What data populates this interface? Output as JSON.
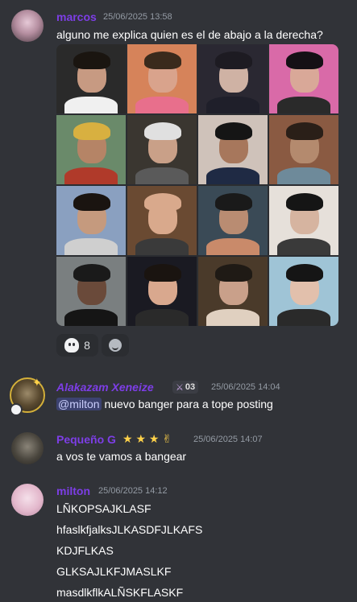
{
  "messages": [
    {
      "username": "marcos",
      "timestamp": "25/06/2025 13:58",
      "text": "alguno me explica quien es el de abajo a la derecha?",
      "reactions": [
        {
          "icon": "ghost-emoji-icon",
          "count": "8"
        },
        {
          "icon": "add-reaction-icon",
          "count": ""
        }
      ]
    },
    {
      "username": "Alakazam Xeneize",
      "badge": "03",
      "timestamp": "25/06/2025 14:04",
      "mention": "@milton",
      "text": " nuevo banger para a tope posting"
    },
    {
      "username": "Pequeño G",
      "decoration": "★ ★ ★ ✌",
      "timestamp": "25/06/2025 14:07",
      "text": "a vos te vamos a bangear"
    },
    {
      "username": "milton",
      "timestamp": "25/06/2025 14:12",
      "lines": [
        "LÑKOPSAJKLASF",
        "hfaslkfjalksJLKASDFJLKAFS",
        "KDJFLKAS",
        "GLKSAJLKFJMASLKF",
        "masdlkflkALÑSKFLASKF"
      ]
    }
  ],
  "colors": {
    "background": "#313338",
    "username": "#7d3ee6",
    "mention_bg": "#3c4270"
  },
  "image_grid_tiles": [
    {
      "bg": "#2a2a2a",
      "face": "#c79a82",
      "hair": "#1a1510",
      "shirt": "#f0f0f0"
    },
    {
      "bg": "#d6835a",
      "face": "#d9a38c",
      "hair": "#3a2a1c",
      "shirt": "#e86f8c"
    },
    {
      "bg": "#2a2832",
      "face": "#cfb2a4",
      "hair": "#1d1b22",
      "shirt": "#1f1f2a"
    },
    {
      "bg": "#d96aa8",
      "face": "#d9a898",
      "hair": "#151015",
      "shirt": "#2a2a2a"
    },
    {
      "bg": "#6a8a6a",
      "face": "#b58466",
      "hair": "#d8b040",
      "shirt": "#b03a2a"
    },
    {
      "bg": "#3a3630",
      "face": "#c9a088",
      "hair": "#e0e0e0",
      "shirt": "#5a5a5a"
    },
    {
      "bg": "#cfc2ba",
      "face": "#a7775c",
      "hair": "#151515",
      "shirt": "#1f2a44"
    },
    {
      "bg": "#8a5a42",
      "face": "#b48a6e",
      "hair": "#2a1f18",
      "shirt": "#6e8a9a"
    },
    {
      "bg": "#8aa0c0",
      "face": "#c59a7e",
      "hair": "#1a1410",
      "shirt": "#cfcfcf"
    },
    {
      "bg": "#6a4a32",
      "face": "#d9a98c",
      "hair": "#d9a98c",
      "shirt": "#3a3a3a"
    },
    {
      "bg": "#3a4a56",
      "face": "#b98c72",
      "hair": "#1a1a1a",
      "shirt": "#c98a6a"
    },
    {
      "bg": "#e6e0da",
      "face": "#d6b4a0",
      "hair": "#151515",
      "shirt": "#3a3a3a"
    },
    {
      "bg": "#7a7f80",
      "face": "#6a4a3a",
      "hair": "#1a1a1a",
      "shirt": "#151515"
    },
    {
      "bg": "#1a1a22",
      "face": "#d9a88e",
      "hair": "#1a1410",
      "shirt": "#2a2a2a"
    },
    {
      "bg": "#4a3a2a",
      "face": "#c9a08a",
      "hair": "#1f1a15",
      "shirt": "#e0d0c0"
    },
    {
      "bg": "#9fc4d6",
      "face": "#e2c0ac",
      "hair": "#151515",
      "shirt": "#2a2a2a"
    }
  ]
}
